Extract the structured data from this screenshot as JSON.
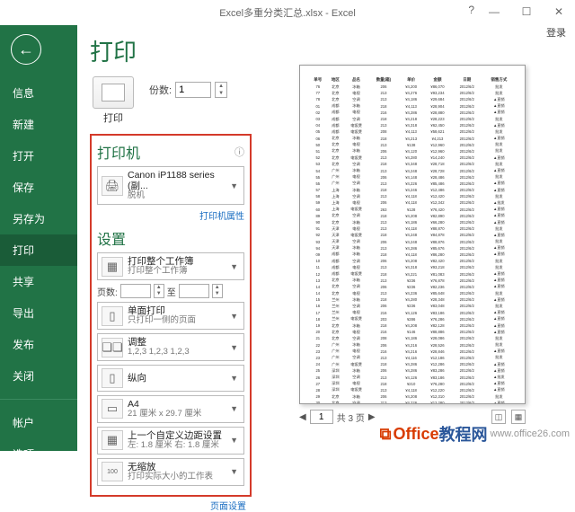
{
  "titlebar": {
    "title": "Excel多重分类汇总.xlsx - Excel",
    "login": "登录",
    "help": "?"
  },
  "sidebar": {
    "items": [
      "信息",
      "新建",
      "打开",
      "保存",
      "另存为",
      "打印",
      "共享",
      "导出",
      "发布",
      "关闭"
    ],
    "footer": [
      "帐户",
      "选项"
    ]
  },
  "page": {
    "title": "打印"
  },
  "printBtn": {
    "label": "打印"
  },
  "copies": {
    "label": "份数:",
    "value": "1"
  },
  "printer": {
    "heading": "打印机",
    "name": "Canon iP1188 series (副...",
    "status": "脱机",
    "propsLink": "打印机属性"
  },
  "settings": {
    "heading": "设置",
    "what": {
      "t1": "打印整个工作簿",
      "t2": "打印整个工作簿"
    },
    "pages": {
      "label": "页数:",
      "to": "至"
    },
    "side": {
      "t1": "单面打印",
      "t2": "只打印一侧的页面"
    },
    "collate": {
      "t1": "调整",
      "t2": "1,2,3   1,2,3   1,2,3"
    },
    "orient": {
      "t1": "纵向"
    },
    "paper": {
      "t1": "A4",
      "t2": "21 厘米 x 29.7 厘米"
    },
    "margin": {
      "t1": "上一个自定义边距设置",
      "t2": "左: 1.8 厘米   右: 1.8 厘米"
    },
    "scale": {
      "t1": "无缩放",
      "t2": "打印实际大小的工作表"
    },
    "pageSetup": "页面设置"
  },
  "pager": {
    "current": "1",
    "total": "共 3 页"
  },
  "watermark": {
    "brand1": "Office",
    "brand2": "教程网",
    "url": "www.office26.com"
  },
  "previewHeaders": [
    "单号",
    "地区",
    "品名",
    "数量(箱)",
    "单价",
    "金额",
    "日期",
    "销售方式"
  ],
  "previewDateBase": "2012/6/2",
  "previewRows": [
    [
      "76",
      "北京",
      "冰箱",
      "206",
      "¥4,200",
      "¥86,070",
      "2012/6/2",
      "批发"
    ],
    [
      "77",
      "北京",
      "电视",
      "213",
      "¥4,276",
      "¥93,234",
      "2012/6/2",
      "批发"
    ],
    [
      "78",
      "北京",
      "空调",
      "213",
      "¥4,186",
      "¥29,684",
      "2012/6/2",
      "▲直销"
    ],
    [
      "01",
      "成都",
      "冰箱",
      "218",
      "¥4,113",
      "¥28,904",
      "2012/6/2",
      "▲直销"
    ],
    [
      "02",
      "成都",
      "电视",
      "216",
      "¥4,286",
      "¥28,880",
      "2012/6/2",
      "▲直销"
    ],
    [
      "03",
      "成都",
      "空调",
      "218",
      "¥4,218",
      "¥28,223",
      "2012/6/2",
      "批发"
    ],
    [
      "04",
      "成都",
      "电饭煲",
      "213",
      "¥4,318",
      "¥62,450",
      "2012/6/2",
      "▲直销"
    ],
    [
      "05",
      "成都",
      "电饭煲",
      "208",
      "¥4,113",
      "¥58,621",
      "2012/6/2",
      "批发"
    ],
    [
      "06",
      "北京",
      "冰箱",
      "218",
      "¥4,213",
      "¥4,213",
      "2012/6/2",
      "▲直销"
    ],
    [
      "50",
      "北京",
      "电视",
      "213",
      "¥138",
      "¥12,960",
      "2012/6/2",
      "批发"
    ],
    [
      "51",
      "北京",
      "冰箱",
      "206",
      "¥4,120",
      "¥12,960",
      "2012/6/2",
      "批发"
    ],
    [
      "52",
      "北京",
      "电饭煲",
      "213",
      "¥4,280",
      "¥14,240",
      "2012/6/2",
      "▲直销"
    ],
    [
      "53",
      "北京",
      "空调",
      "218",
      "¥4,348",
      "¥28,718",
      "2012/6/2",
      "批发"
    ],
    [
      "54",
      "广州",
      "冰箱",
      "213",
      "¥4,248",
      "¥28,728",
      "2012/6/2",
      "▲直销"
    ],
    [
      "55",
      "广州",
      "电视",
      "206",
      "¥4,148",
      "¥28,486",
      "2012/6/2",
      "批发"
    ],
    [
      "55",
      "广州",
      "空调",
      "213",
      "¥4,226",
      "¥85,486",
      "2012/6/2",
      "▲直销"
    ],
    [
      "57",
      "上海",
      "冰箱",
      "218",
      "¥4,246",
      "¥12,486",
      "2012/6/2",
      "▲直销"
    ],
    [
      "58",
      "上海",
      "空调",
      "213",
      "¥4,118",
      "¥12,420",
      "2012/6/2",
      "批发"
    ],
    [
      "59",
      "上海",
      "电视",
      "206",
      "¥4,118",
      "¥12,342",
      "2012/6/2",
      "▲批发"
    ],
    [
      "60",
      "上海",
      "电饭煲",
      "263",
      "¥128",
      "¥76,420",
      "2012/6/2",
      "▲直销"
    ],
    [
      "89",
      "北京",
      "空调",
      "218",
      "¥4,208",
      "¥82,890",
      "2012/6/2",
      "▲直销"
    ],
    [
      "90",
      "北京",
      "冰箱",
      "213",
      "¥4,186",
      "¥66,280",
      "2012/6/2",
      "▲直销"
    ],
    [
      "91",
      "天津",
      "电视",
      "213",
      "¥4,118",
      "¥88,870",
      "2012/6/2",
      "批发"
    ],
    [
      "92",
      "天津",
      "电饭煲",
      "218",
      "¥4,248",
      "¥84,878",
      "2012/6/2",
      "▲直销"
    ],
    [
      "93",
      "天津",
      "空调",
      "206",
      "¥4,248",
      "¥88,876",
      "2012/6/2",
      "批发"
    ],
    [
      "94",
      "天津",
      "冰箱",
      "213",
      "¥4,286",
      "¥85,676",
      "2012/6/2",
      "▲直销"
    ],
    [
      "09",
      "成都",
      "冰箱",
      "218",
      "¥4,118",
      "¥86,280",
      "2012/6/2",
      "▲直销"
    ],
    [
      "10",
      "成都",
      "空调",
      "206",
      "¥4,208",
      "¥82,420",
      "2012/6/2",
      "批发"
    ],
    [
      "11",
      "成都",
      "电视",
      "213",
      "¥4,318",
      "¥93,218",
      "2012/6/2",
      "批发"
    ],
    [
      "12",
      "成都",
      "电饭煲",
      "218",
      "¥4,221",
      "¥81,083",
      "2012/6/2",
      "▲直销"
    ],
    [
      "13",
      "北京",
      "冰箱",
      "213",
      "¥236",
      "¥76,878",
      "2012/6/2",
      "▲直销"
    ],
    [
      "14",
      "北京",
      "空调",
      "206",
      "¥236",
      "¥82,236",
      "2012/6/2",
      "▲直销"
    ],
    [
      "14",
      "北京",
      "电视",
      "213",
      "¥4,236",
      "¥85,648",
      "2012/6/2",
      "批发"
    ],
    [
      "15",
      "兰州",
      "冰箱",
      "218",
      "¥4,280",
      "¥28,348",
      "2012/6/2",
      "▲直销"
    ],
    [
      "16",
      "兰州",
      "空调",
      "206",
      "¥236",
      "¥83,048",
      "2012/6/2",
      "批发"
    ],
    [
      "17",
      "兰州",
      "电视",
      "216",
      "¥4,126",
      "¥83,186",
      "2012/6/2",
      "▲直销"
    ],
    [
      "18",
      "兰州",
      "电饭煲",
      "203",
      "¥286",
      "¥76,286",
      "2012/6/2",
      "▲直销"
    ],
    [
      "19",
      "北京",
      "冰箱",
      "218",
      "¥4,208",
      "¥82,128",
      "2012/6/2",
      "▲直销"
    ],
    [
      "20",
      "北京",
      "电视",
      "216",
      "¥146",
      "¥88,886",
      "2012/6/2",
      "▲直销"
    ],
    [
      "21",
      "北京",
      "空调",
      "208",
      "¥4,186",
      "¥28,086",
      "2012/6/2",
      "批发"
    ],
    [
      "22",
      "广州",
      "冰箱",
      "206",
      "¥4,216",
      "¥28,526",
      "2012/6/2",
      "批发"
    ],
    [
      "23",
      "广州",
      "电视",
      "216",
      "¥4,216",
      "¥28,846",
      "2012/6/2",
      "▲直销"
    ],
    [
      "23",
      "广州",
      "空调",
      "213",
      "¥4,116",
      "¥12,186",
      "2012/6/2",
      "批发"
    ],
    [
      "24",
      "广州",
      "电饭煲",
      "218",
      "¥4,286",
      "¥12,286",
      "2012/6/2",
      "▲直销"
    ],
    [
      "25",
      "深圳",
      "冰箱",
      "206",
      "¥4,286",
      "¥83,286",
      "2012/6/2",
      "▲直销"
    ],
    [
      "26",
      "深圳",
      "空调",
      "213",
      "¥4,126",
      "¥83,186",
      "2012/6/2",
      "▲批发"
    ],
    [
      "27",
      "深圳",
      "电视",
      "218",
      "¥210",
      "¥76,280",
      "2012/6/2",
      "▲直销"
    ],
    [
      "28",
      "深圳",
      "电饭煲",
      "213",
      "¥4,118",
      "¥12,220",
      "2012/6/2",
      "▲直销"
    ],
    [
      "29",
      "北京",
      "冰箱",
      "206",
      "¥4,208",
      "¥12,310",
      "2012/6/2",
      "批发"
    ],
    [
      "30",
      "北京",
      "空调",
      "213",
      "¥4,226",
      "¥12,280",
      "2012/6/3",
      "▲直销"
    ],
    [
      "31",
      "北京",
      "电视",
      "218",
      "¥4,246",
      "¥88,876",
      "2012/6/3",
      "批发"
    ],
    [
      "32",
      "武汉",
      "冰箱",
      "213",
      "¥126",
      "¥28,276",
      "2012/6/3",
      "▲直销"
    ]
  ]
}
